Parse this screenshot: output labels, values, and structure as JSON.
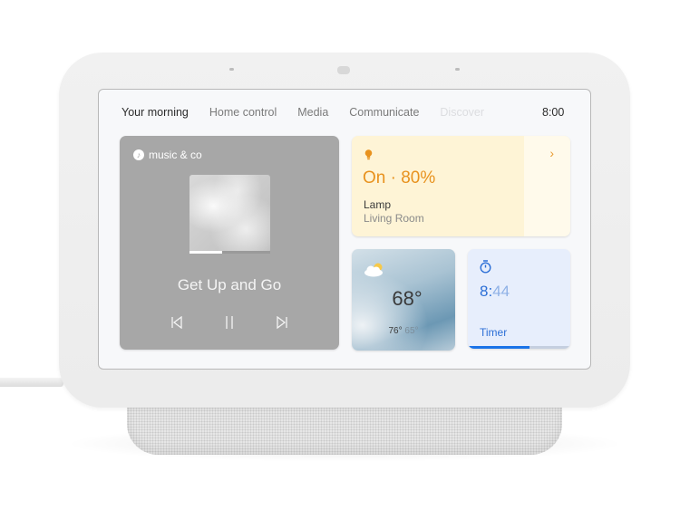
{
  "header": {
    "tabs": [
      {
        "label": "Your morning",
        "state": "active"
      },
      {
        "label": "Home control",
        "state": "normal"
      },
      {
        "label": "Media",
        "state": "normal"
      },
      {
        "label": "Communicate",
        "state": "normal"
      },
      {
        "label": "Discover",
        "state": "faded"
      }
    ],
    "clock": "8:00"
  },
  "media": {
    "source": "music & co",
    "source_icon": "music-note-icon",
    "song_title": "Get Up and Go",
    "progress_fraction": 0.4,
    "controls": [
      "skip-previous-icon",
      "pause-icon",
      "skip-next-icon"
    ]
  },
  "lamp": {
    "icon": "lightbulb-icon",
    "state": "On · 80%",
    "name": "Lamp",
    "room": "Living Room",
    "chevron": "›",
    "accent": "#e8921e"
  },
  "weather": {
    "icon": "partly-cloudy-icon",
    "temp": "68°",
    "high": "76°",
    "low": "65°"
  },
  "timer": {
    "icon": "stopwatch-icon",
    "minutes": "8:",
    "seconds": "44",
    "label": "Timer",
    "progress_fraction": 0.6,
    "accent": "#1a73e8"
  }
}
